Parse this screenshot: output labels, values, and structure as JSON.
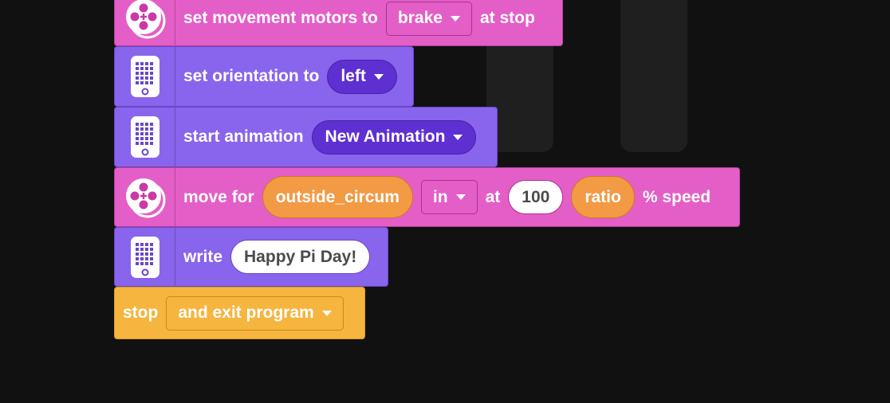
{
  "blocks": {
    "set_motors": {
      "text_before": "set movement motors to",
      "dropdown": "brake",
      "text_after": "at stop"
    },
    "set_orientation": {
      "text": "set orientation to",
      "dropdown": "left"
    },
    "start_animation": {
      "text": "start animation",
      "dropdown": "New Animation"
    },
    "move_for": {
      "text_before": "move for",
      "distance_var": "outside_circum",
      "unit_dropdown": "in",
      "text_at": "at",
      "speed_value": "100",
      "ratio_var": "ratio",
      "text_after": "% speed"
    },
    "write": {
      "text": "write",
      "value": "Happy Pi Day!"
    },
    "stop": {
      "text": "stop",
      "dropdown": "and exit program"
    }
  },
  "icons": {
    "motor_pair": "motor-pair-icon",
    "hub_matrix": "hub-light-matrix-icon",
    "caret": "caret-down-icon"
  },
  "colors": {
    "pink": "#e45ec7",
    "purple": "#8964ec",
    "yellow": "#f5b53f",
    "orange": "#f39a45",
    "background": "#111111"
  }
}
